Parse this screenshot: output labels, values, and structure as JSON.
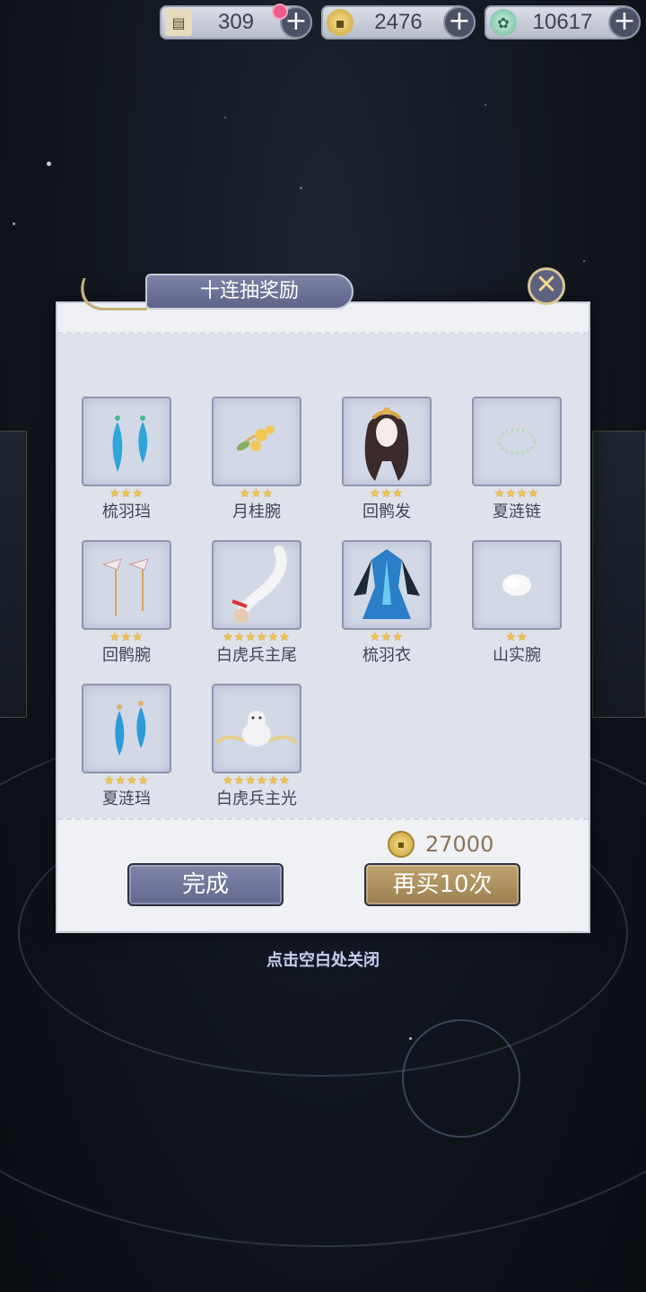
{
  "currencies": [
    {
      "icon": "scroll-ticket-icon",
      "value": "309",
      "has_notification": true
    },
    {
      "icon": "gold-coin-icon",
      "value": "2476",
      "has_notification": false
    },
    {
      "icon": "jade-gem-icon",
      "value": "10617",
      "has_notification": false
    }
  ],
  "dialog": {
    "title": "十连抽奖励",
    "items": [
      {
        "name": "梳羽珰",
        "stars": "★★★",
        "icon": "blue-feather-earrings-icon"
      },
      {
        "name": "月桂腕",
        "stars": "★★★",
        "icon": "laurel-flower-bracelet-icon"
      },
      {
        "name": "回鹘发",
        "stars": "★★★",
        "icon": "long-hair-headpiece-icon"
      },
      {
        "name": "夏涟链",
        "stars": "★★★★",
        "icon": "pearl-necklace-icon"
      },
      {
        "name": "回鹘腕",
        "stars": "★★★",
        "icon": "tassel-bracelet-icon"
      },
      {
        "name": "白虎兵主尾",
        "stars": "★★★★★★",
        "icon": "white-tiger-tail-icon"
      },
      {
        "name": "梳羽衣",
        "stars": "★★★",
        "icon": "blue-feather-dress-icon"
      },
      {
        "name": "山实腕",
        "stars": "★★",
        "icon": "white-fur-cuff-icon"
      },
      {
        "name": "夏涟珰",
        "stars": "★★★★",
        "icon": "blue-drop-earrings-icon"
      },
      {
        "name": "白虎兵主光",
        "stars": "★★★★★★",
        "icon": "white-tiger-aura-icon"
      }
    ],
    "cost": "27000",
    "done_label": "完成",
    "buy_again_label": "再买10次"
  },
  "hint": "点击空白处关闭"
}
